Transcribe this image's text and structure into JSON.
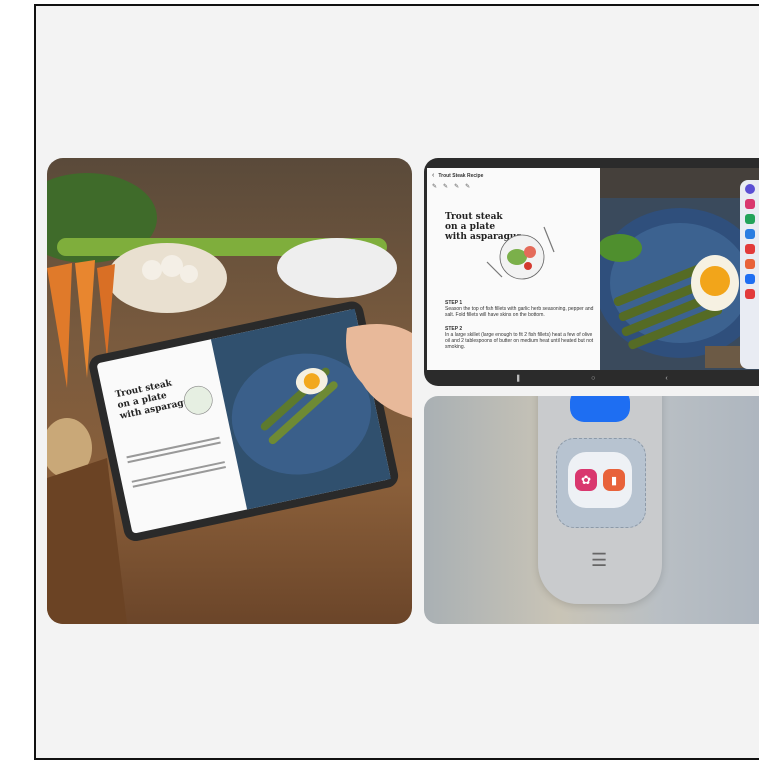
{
  "note": {
    "title_bar": "Trout Steak Recipe",
    "handwritten_title": [
      "Trout steak",
      "on a plate",
      "with asparagus"
    ],
    "steps": [
      {
        "label": "STEP 1",
        "text": "Season the top of fish fillets with garlic herb seasoning, pepper and salt. Fold fillets will have skins on the bottom."
      },
      {
        "label": "STEP 2",
        "text": "In a large skillet (large enough to fit 2 fish fillets) heat a few of olive oil and 2 tablespoons of butter on medium heat until heated but not smoking."
      }
    ]
  },
  "colors": {
    "frame_bg": "#f3f3f3",
    "dock_app_notes": "#d9376e",
    "dock_app_gallery": "#e8623a",
    "video_app": "#1e6ef2"
  },
  "icons": [
    "back-arrow-icon",
    "pen-icon",
    "menu-icon",
    "video-call-icon",
    "flower-app-icon",
    "notes-app-icon"
  ]
}
